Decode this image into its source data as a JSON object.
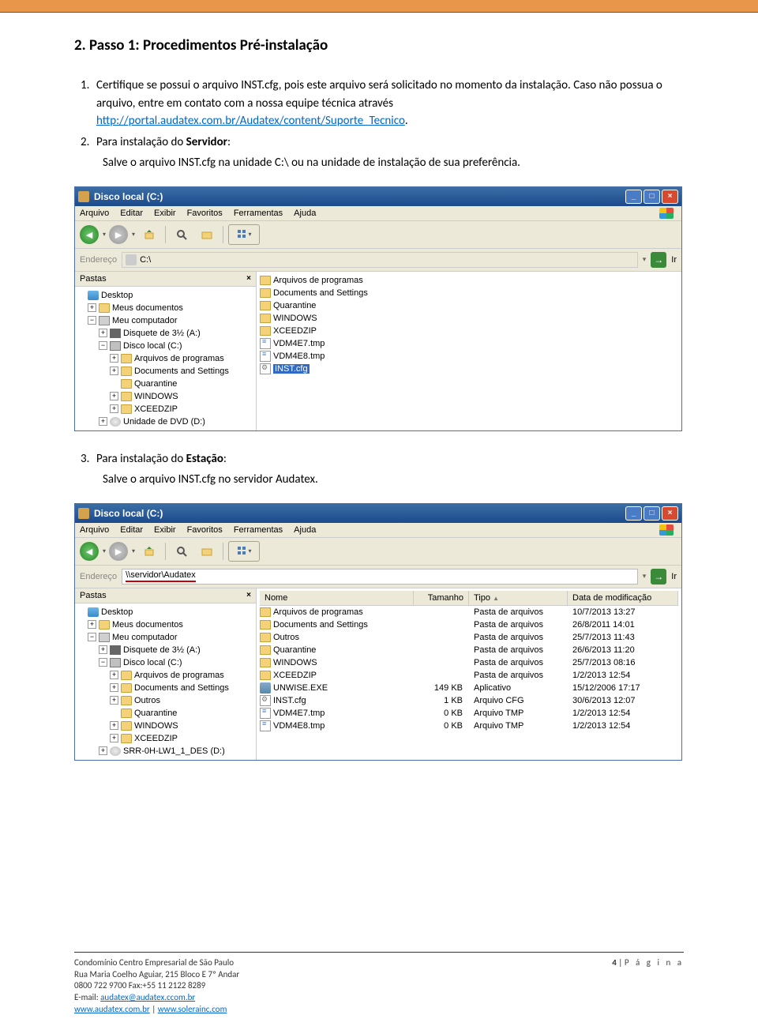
{
  "heading": "2. Passo 1: Procedimentos Pré-instalação",
  "item1_num": "1.",
  "item1_text_a": "Certifique se possui o arquivo INST.cfg, pois este arquivo será solicitado no momento da instalação. Caso não possua o arquivo, entre em contato com a nossa equipe técnica através ",
  "item1_link": "http://portal.audatex.com.br/Audatex/content/Suporte_Tecnico",
  "item1_dot": ".",
  "item2_num": "2.",
  "item2_text_a": "Para instalação do ",
  "item2_bold": "Servidor",
  "item2_text_b": ":",
  "item2_sub": "Salve o arquivo INST.cfg na unidade C:\\ ou na unidade de instalação de sua preferência.",
  "item3_num": "3.",
  "item3_text_a": "Para instalação do ",
  "item3_bold": "Estação",
  "item3_text_b": ":",
  "item3_sub": "Salve o arquivo INST.cfg no servidor Audatex.",
  "explorer": {
    "title": "Disco local (C:)",
    "menu": [
      "Arquivo",
      "Editar",
      "Exibir",
      "Favoritos",
      "Ferramentas",
      "Ajuda"
    ],
    "addr_label": "Endereço",
    "addr1": "C:\\",
    "addr2": "\\\\servidor\\Audatex",
    "go": "Ir",
    "pastas": "Pastas",
    "tree": {
      "desktop": "Desktop",
      "meusdocs": "Meus documentos",
      "meupc": "Meu computador",
      "floppy": "Disquete de 3½ (A:)",
      "disco": "Disco local (C:)",
      "arqprog": "Arquivos de programas",
      "docset": "Documents and Settings",
      "outros": "Outros",
      "quar": "Quarantine",
      "win": "WINDOWS",
      "xceed": "XCEEDZIP",
      "dvd": "Unidade de DVD (D:)",
      "srr": "SRR-0H-LW1_1_DES (D:)"
    },
    "cols": {
      "nome": "Nome",
      "tamanho": "Tamanho",
      "tipo": "Tipo",
      "data": "Data de modificação"
    },
    "list1": [
      {
        "name": "Arquivos de programas",
        "icon": "folder"
      },
      {
        "name": "Documents and Settings",
        "icon": "folder"
      },
      {
        "name": "Quarantine",
        "icon": "folder"
      },
      {
        "name": "WINDOWS",
        "icon": "folder"
      },
      {
        "name": "XCEEDZIP",
        "icon": "folder"
      },
      {
        "name": "VDM4E7.tmp",
        "icon": "tmp"
      },
      {
        "name": "VDM4E8.tmp",
        "icon": "tmp"
      },
      {
        "name": "INST.cfg",
        "icon": "cfg",
        "selected": true
      }
    ],
    "list2": [
      {
        "name": "Arquivos de programas",
        "icon": "folder",
        "size": "",
        "type": "Pasta de arquivos",
        "date": "10/7/2013 13:27"
      },
      {
        "name": "Documents and Settings",
        "icon": "folder",
        "size": "",
        "type": "Pasta de arquivos",
        "date": "26/8/2011 14:01"
      },
      {
        "name": "Outros",
        "icon": "folder",
        "size": "",
        "type": "Pasta de arquivos",
        "date": "25/7/2013 11:43"
      },
      {
        "name": "Quarantine",
        "icon": "folder",
        "size": "",
        "type": "Pasta de arquivos",
        "date": "26/6/2013 11:20"
      },
      {
        "name": "WINDOWS",
        "icon": "folder",
        "size": "",
        "type": "Pasta de arquivos",
        "date": "25/7/2013 08:16"
      },
      {
        "name": "XCEEDZIP",
        "icon": "folder",
        "size": "",
        "type": "Pasta de arquivos",
        "date": "1/2/2013 12:54"
      },
      {
        "name": "UNWISE.EXE",
        "icon": "exe",
        "size": "149 KB",
        "type": "Aplicativo",
        "date": "15/12/2006 17:17"
      },
      {
        "name": "INST.cfg",
        "icon": "cfg",
        "size": "1 KB",
        "type": "Arquivo CFG",
        "date": "30/6/2013 12:07"
      },
      {
        "name": "VDM4E7.tmp",
        "icon": "tmp",
        "size": "0 KB",
        "type": "Arquivo TMP",
        "date": "1/2/2013 12:54"
      },
      {
        "name": "VDM4E8.tmp",
        "icon": "tmp",
        "size": "0 KB",
        "type": "Arquivo TMP",
        "date": "1/2/2013 12:54"
      }
    ]
  },
  "footer": {
    "l1": "Condomínio Centro Empresarial de São Paulo",
    "l2": "Rua Maria Coelho Aguiar, 215 Bloco E 7º Andar",
    "l3": "0800 722 9700 Fax:+55 11 2122 8289",
    "l4_pre": "E-mail: ",
    "l4_link": "audatex@audatex.ccom.br",
    "l5_a": "www.audatex.com.br",
    "l5_sep": " | ",
    "l5_b": "www.solerainc.com",
    "pagenum": "4",
    "pageword": "P á g i n a"
  }
}
